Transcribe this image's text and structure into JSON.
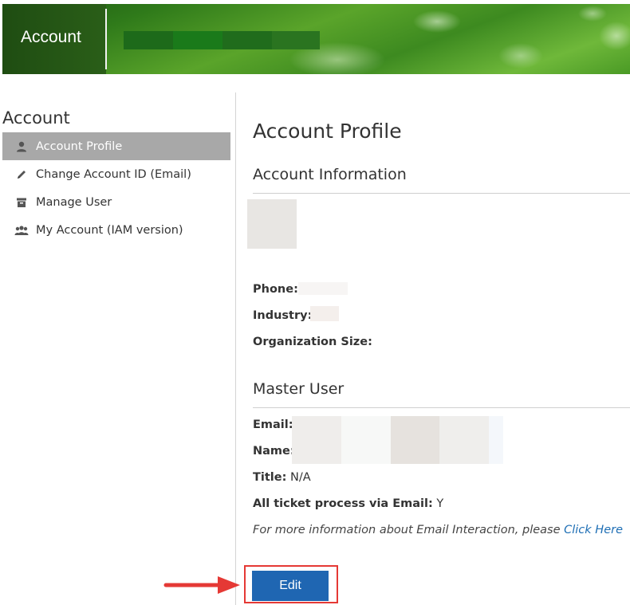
{
  "header": {
    "title": "Account"
  },
  "sidebar": {
    "title": "Account",
    "items": [
      {
        "label": "Account Profile",
        "icon": "user-icon",
        "active": true
      },
      {
        "label": "Change Account ID (Email)",
        "icon": "pencil-icon",
        "active": false
      },
      {
        "label": "Manage User",
        "icon": "archive-box-icon",
        "active": false
      },
      {
        "label": "My Account (IAM version)",
        "icon": "users-group-icon",
        "active": false
      }
    ]
  },
  "main": {
    "page_title": "Account Profile",
    "account_info": {
      "title": "Account Information",
      "phone_label": "Phone:",
      "industry_label": "Industry:",
      "org_size_label": "Organization Size:"
    },
    "master_user": {
      "title": "Master User",
      "email_label": "Email:",
      "name_label": "Name:",
      "title_label": "Title:",
      "title_value": "N/A",
      "ticket_label": "All ticket process via Email:",
      "ticket_value": "Y",
      "info_text": "For more information about Email Interaction, please ",
      "info_link": "Click Here"
    },
    "edit_label": "Edit"
  },
  "colors": {
    "active_sidebar_bg": "#a8a8a8",
    "button_blue": "#1f66b2",
    "highlight_red": "#e53935",
    "link_blue": "#1f6fb5"
  }
}
